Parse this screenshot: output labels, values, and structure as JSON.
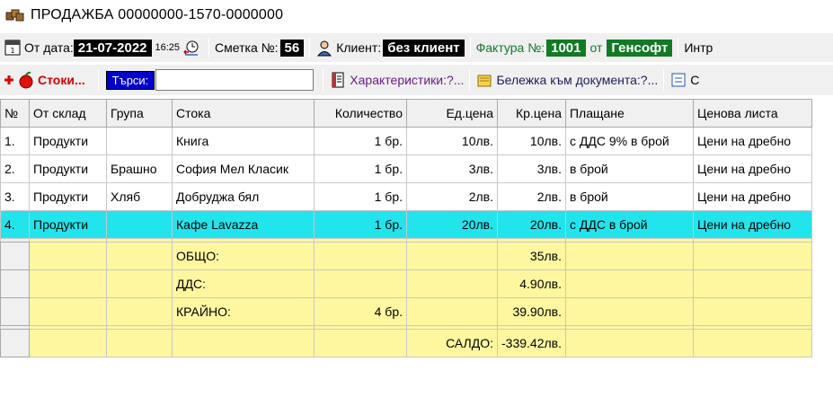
{
  "window": {
    "title": "ПРОДАЖБА 00000000-1570-0000000"
  },
  "toolbar1": {
    "date_label": "От дата:",
    "date_value": "21-07-2022",
    "time_value": "16:25",
    "account_label": "Сметка №:",
    "account_value": "56",
    "client_label": "Клиент:",
    "client_value": "без клиент",
    "invoice_label": "Фактура №:",
    "invoice_value": "1001",
    "from_label": "от",
    "company_value": "Генсофт",
    "more_label": "Интр"
  },
  "toolbar2": {
    "goods_label": "Стоки...",
    "search_label": "Търси:",
    "search_value": "",
    "characteristics_label": "Характеристики:?...",
    "note_label": "Бележка към документа:?...",
    "overflow_label": "С"
  },
  "grid": {
    "columns": [
      "№",
      "От склад",
      "Група",
      "Стока",
      "Количество",
      "Ед.цена",
      "Кр.цена",
      "Плащане",
      "Ценова листа"
    ],
    "rows": [
      [
        "1.",
        "Продукти",
        "",
        "Книга",
        "1 бр.",
        "10лв.",
        "10лв.",
        "с ДДС 9% в брой",
        "Цени на дребно"
      ],
      [
        "2.",
        "Продукти",
        "Брашно",
        "София Мел Класик",
        "1 бр.",
        "3лв.",
        "3лв.",
        "в брой",
        "Цени на дребно"
      ],
      [
        "3.",
        "Продукти",
        "Хляб",
        "Добруджа бял",
        "1 бр.",
        "2лв.",
        "2лв.",
        "в брой",
        "Цени на дребно"
      ],
      [
        "4.",
        "Продукти",
        "",
        "Кафе Lavazza",
        "1 бр.",
        "20лв.",
        "20лв.",
        "с ДДС в брой",
        "Цени на дребно"
      ]
    ],
    "summary": {
      "total_label": "ОБЩО:",
      "total_value": "35лв.",
      "vat_label": "ДДС:",
      "vat_value": "4.90лв.",
      "final_label": "КРАЙНО:",
      "final_qty": "4 бр.",
      "final_value": "39.90лв.",
      "balance_label": "САЛДО:",
      "balance_value": "-339.42лв."
    }
  }
}
